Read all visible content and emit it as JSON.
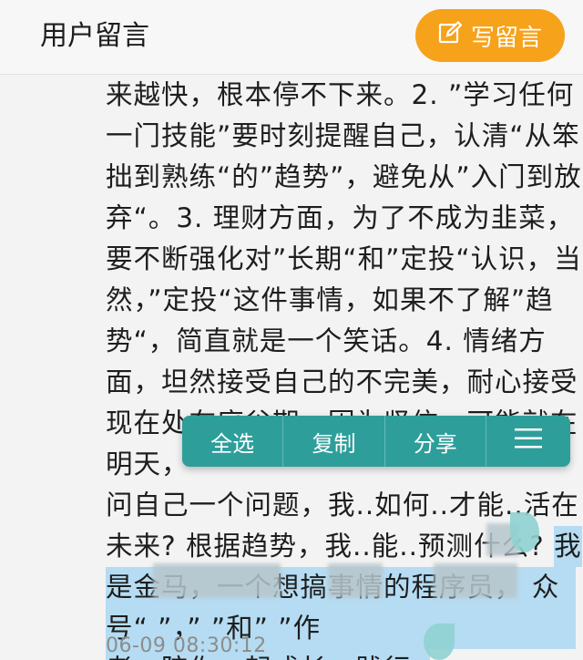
{
  "header": {
    "title": "用户留言",
    "write_label": "写留言"
  },
  "comment": {
    "lines": [
      "来越快，根本停不下来。2. ”学习任何",
      "一门技能”要时刻提醒自己，认清“从笨",
      "拙到熟练“的”趋势”，避免从”入门到放",
      "弃“。3. 理财方面，为了不成为韭菜，",
      "要不断强化对”长期“和”定投“认识，当",
      "然，”定投“这件事情，如果不了解”趋",
      "势“，简直就是一个笑话。4. 情绪方",
      "面，坦然接受自己的不完美，耐心接受",
      "现在处在底谷期，因为坚信，可能就在",
      "明天，",
      "问自己",
      "未来? 根据趋势，我..能..预测什么? "
    ],
    "line10_tail": "一个问题，我..如何..才能..活在",
    "line11_selected": "我",
    "selected_lines": [
      "是金马，一个想搞事情的程序员，  众",
      "号“        ”，”        ”和”        ”作",
      "者，陪你一起成长、践行。"
    ],
    "timestamp": "06-09 08:30:12"
  },
  "toolbar": {
    "select_all": "全选",
    "copy": "复制",
    "share": "分享",
    "menu_icon": "hamburger-icon"
  },
  "colors": {
    "accent_orange": "#f7a21b",
    "toolbar_teal": "#2e9e9a",
    "selection_blue": "#b5dcf2"
  }
}
